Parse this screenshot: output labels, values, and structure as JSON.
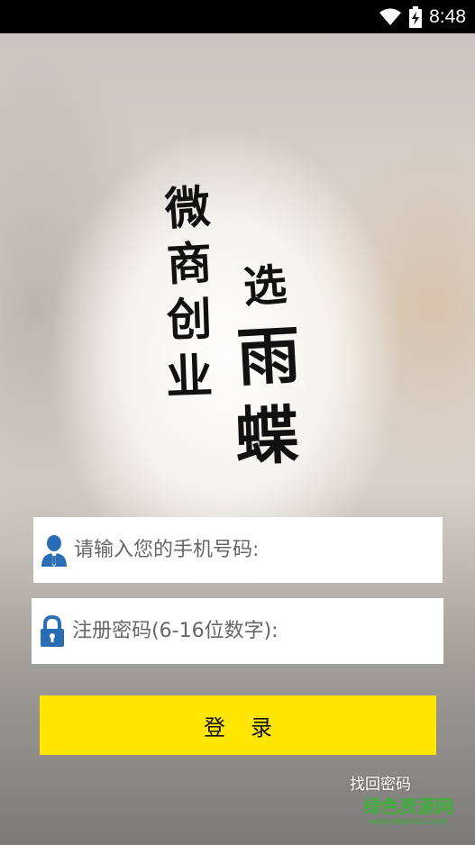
{
  "status_bar": {
    "time": "8:48",
    "icons": [
      "wifi-icon",
      "battery-charging-icon"
    ]
  },
  "logo": {
    "column_left": [
      "微",
      "商",
      "创",
      "业"
    ],
    "column_right": [
      "选",
      "雨",
      "蝶"
    ]
  },
  "phone_field": {
    "placeholder": "请输入您的手机号码:",
    "value": "",
    "icon": "user-icon"
  },
  "password_field": {
    "placeholder": "注册密码(6-16位数字):",
    "value": "",
    "icon": "lock-icon"
  },
  "login_button": {
    "label": "登录"
  },
  "forgot_link": {
    "label": "找回密码"
  },
  "watermark": {
    "title": "绿色资源网",
    "url": "www.downcc.com"
  },
  "colors": {
    "button": "#ffe600",
    "icon_blue": "#2b6db5",
    "status_bar": "#000000",
    "watermark": "#3fae3a"
  }
}
